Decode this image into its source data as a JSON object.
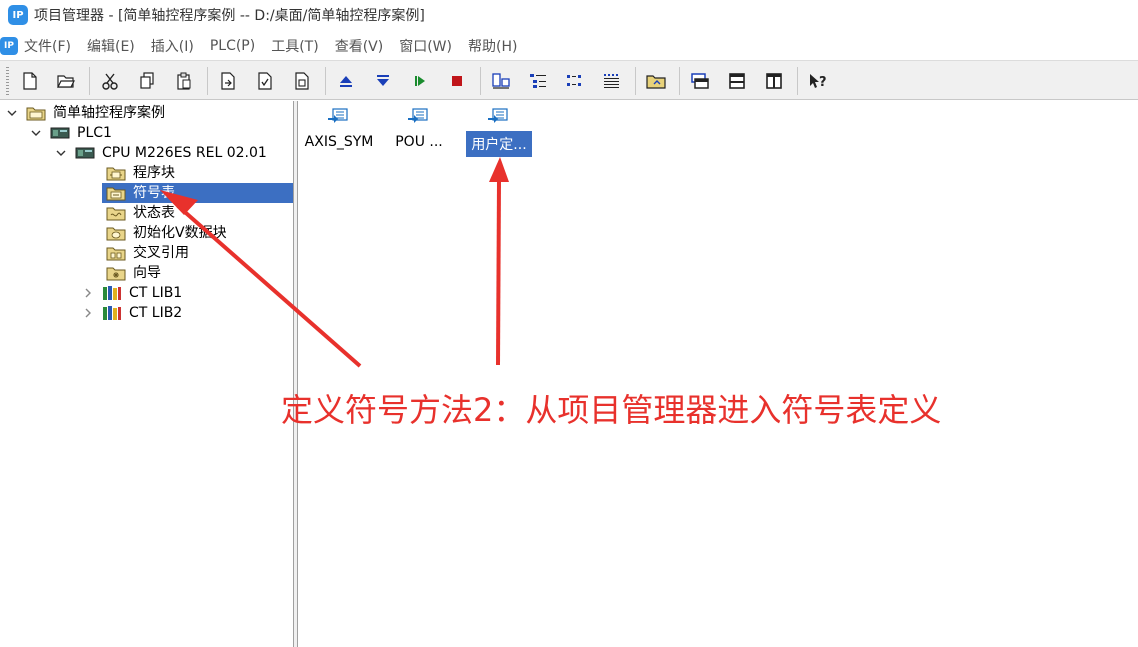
{
  "window": {
    "title": "项目管理器 - [简单轴控程序案例 -- D:/桌面/简单轴控程序案例]",
    "app_icon_text": "IP"
  },
  "menu": {
    "items": [
      "文件(F)",
      "编辑(E)",
      "插入(I)",
      "PLC(P)",
      "工具(T)",
      "查看(V)",
      "窗口(W)",
      "帮助(H)"
    ]
  },
  "toolbar": {
    "buttons": [
      "new-file-icon",
      "open-folder-icon",
      "cut-icon",
      "copy-icon",
      "paste-icon",
      "import-icon",
      "check-icon",
      "compile-icon",
      "upload-icon",
      "download-icon",
      "run-icon",
      "stop-icon",
      "online-icon",
      "list-view-icon",
      "detail-view-icon",
      "grid-view-icon",
      "new-folder-icon",
      "windows-icon",
      "split-horizontal-icon",
      "split-vertical-icon",
      "help-icon"
    ]
  },
  "tree": {
    "root": "简单轴控程序案例",
    "plc": "PLC1",
    "cpu": "CPU M226ES REL 02.01",
    "children": [
      "程序块",
      "符号表",
      "状态表",
      "初始化V数据块",
      "交叉引用",
      "向导"
    ],
    "libs": [
      "CT LIB1",
      "CT LIB2"
    ],
    "selected": "符号表"
  },
  "content": {
    "items": [
      {
        "label": "AXIS_SYM"
      },
      {
        "label": "POU ..."
      },
      {
        "label": "用户定..."
      }
    ],
    "selected": "用户定..."
  },
  "annotation": {
    "text": "定义符号方法2：从项目管理器进入符号表定义",
    "color": "#e8312c"
  },
  "colors": {
    "selection": "#3c6fc2",
    "toolbar_bg": "#f0f0f0",
    "accent": "#2f8fe6"
  }
}
